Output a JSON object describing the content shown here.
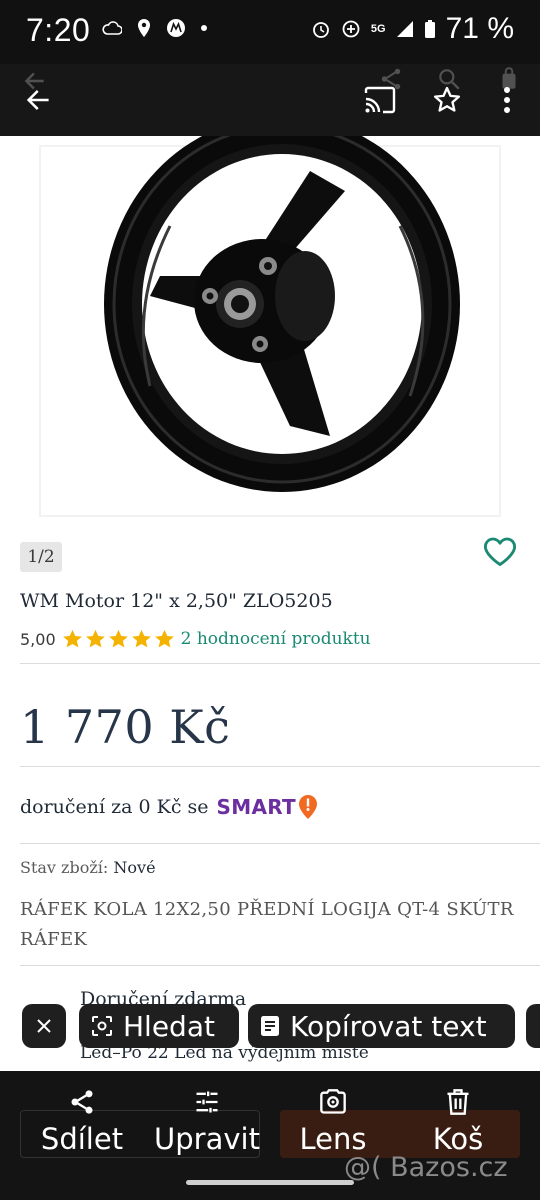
{
  "status_bar": {
    "time": "7:20",
    "network": "5G",
    "battery": "71 %"
  },
  "app_bar": {
    "back_icon": "arrow-left-icon",
    "cast_icon": "cast-icon",
    "star_icon": "star-outline-icon",
    "menu_icon": "more-vert-icon"
  },
  "product": {
    "image_counter": "1/2",
    "title": "WM Motor 12\" x 2,50\" ZLO5205",
    "rating_value": "5,00",
    "stars": 5,
    "rating_link": "2 hodnocení produktu",
    "price": "1 770 Kč",
    "delivery_text": "doručení za 0 Kč se",
    "delivery_brand": "SMART",
    "condition_label": "Stav zboží:",
    "condition_value": "Nové",
    "description": "RÁFEK KOLA 12X2,50 PŘEDNÍ LOGIJA QT-4 SKÚTR RÁFEK",
    "shipping_title": "Doručení zdarma",
    "shipping_sub": "Led–Po 22 Led na výdejním místě"
  },
  "selection_toolbar": {
    "close_icon": "close-icon",
    "search_label": "Hledat",
    "copy_label": "Kopírovat text"
  },
  "bottom_actions": [
    {
      "label": "Sdílet",
      "icon": "share-icon"
    },
    {
      "label": "Upravit",
      "icon": "tune-icon"
    },
    {
      "label": "Lens",
      "icon": "lens-icon"
    },
    {
      "label": "Koš",
      "icon": "trash-icon"
    }
  ],
  "watermark": "@( Bazos.cz",
  "colors": {
    "accent_green": "#1a8a73",
    "star_yellow": "#f5b301",
    "smart_purple": "#6b2fa0",
    "smart_orange": "#f26a21"
  }
}
